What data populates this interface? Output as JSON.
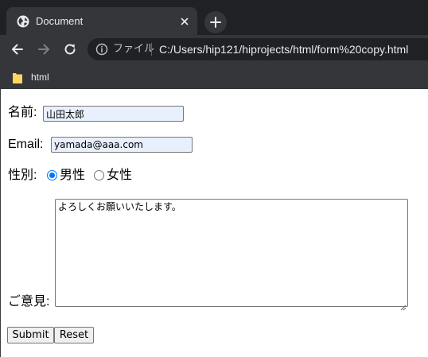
{
  "browser": {
    "tab": {
      "title": "Document",
      "favicon": "globe-icon",
      "close": "close-icon"
    },
    "new_tab": "plus-icon",
    "toolbar": {
      "back": "arrow-left-icon",
      "forward": "arrow-right-icon",
      "reload": "reload-icon",
      "scheme_label": "ファイル",
      "url": "C:/Users/hip121/hiprojects/html/form%20copy.html"
    },
    "bookmarks": [
      {
        "label": "html",
        "icon": "folder-icon"
      }
    ],
    "colors": {
      "chrome_dark": "#202124",
      "chrome": "#35363a",
      "text": "#e8eaed",
      "folder": "#fdd663"
    }
  },
  "form": {
    "name": {
      "label": "名前:",
      "value": "山田太郎"
    },
    "email": {
      "label": "Email:",
      "value": "yamada@aaa.com"
    },
    "gender": {
      "label": "性別:",
      "options": [
        {
          "label": "男性",
          "checked": true
        },
        {
          "label": "女性",
          "checked": false
        }
      ]
    },
    "comment": {
      "label": "ご意見:",
      "value": "よろしくお願いいたします。"
    },
    "submit_label": "Submit",
    "reset_label": "Reset",
    "accent_color": "#0075ff",
    "autofill_color": "#e8f0fe"
  }
}
